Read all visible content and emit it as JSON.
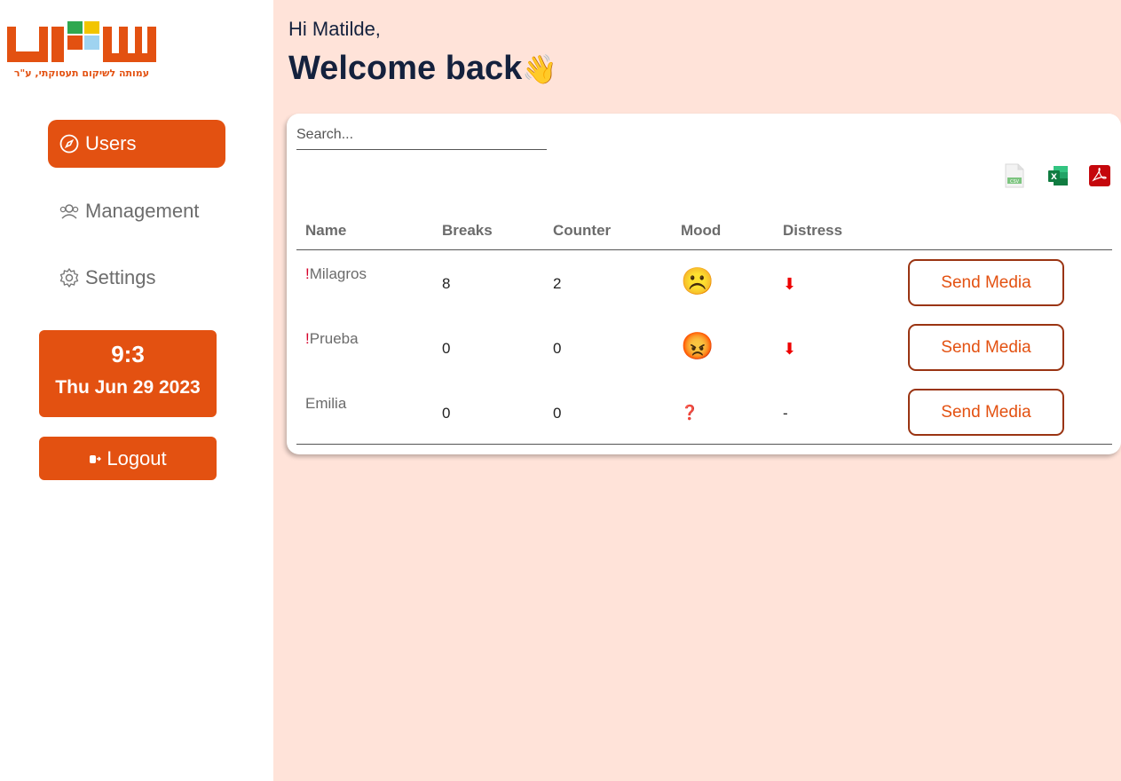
{
  "logo": {
    "tagline": "עמותה לשיקום תעסוקתי, ע\"ר",
    "brand_colors": [
      "#e35111",
      "#2fa84f",
      "#f2c500",
      "#9fd3f0"
    ]
  },
  "sidebar": {
    "items": [
      {
        "label": "Users",
        "icon": "compass-icon",
        "active": true
      },
      {
        "label": "Management",
        "icon": "users-icon",
        "active": false
      },
      {
        "label": "Settings",
        "icon": "gear-icon",
        "active": false
      }
    ],
    "clock": {
      "time": "9:3",
      "date": "Thu Jun 29 2023"
    },
    "logout_label": "Logout"
  },
  "header": {
    "greeting": "Hi Matilde,",
    "welcome": "Welcome back",
    "welcome_emoji": "👋"
  },
  "search": {
    "placeholder": "Search..."
  },
  "exports": [
    {
      "name": "csv-export-icon",
      "label": "CSV"
    },
    {
      "name": "excel-export-icon",
      "label": "X"
    },
    {
      "name": "pdf-export-icon",
      "label": "PDF"
    }
  ],
  "table": {
    "columns": [
      "Name",
      "Breaks",
      "Counter",
      "Mood",
      "Distress"
    ],
    "rows": [
      {
        "flag": "!",
        "name": "Milagros",
        "breaks": "8",
        "counter": "2",
        "mood": "☹️",
        "distress": "⬇",
        "action": "Send Media"
      },
      {
        "flag": "!",
        "name": "Prueba",
        "breaks": "0",
        "counter": "0",
        "mood": "😡",
        "distress": "⬇",
        "action": "Send Media"
      },
      {
        "flag": "",
        "name": "Emilia",
        "breaks": "0",
        "counter": "0",
        "mood": "❓",
        "distress": "-",
        "action": "Send Media"
      }
    ]
  },
  "colors": {
    "accent": "#e35111",
    "background": "#ffe3d9",
    "heading": "#14213d",
    "alert": "#d6002a"
  }
}
